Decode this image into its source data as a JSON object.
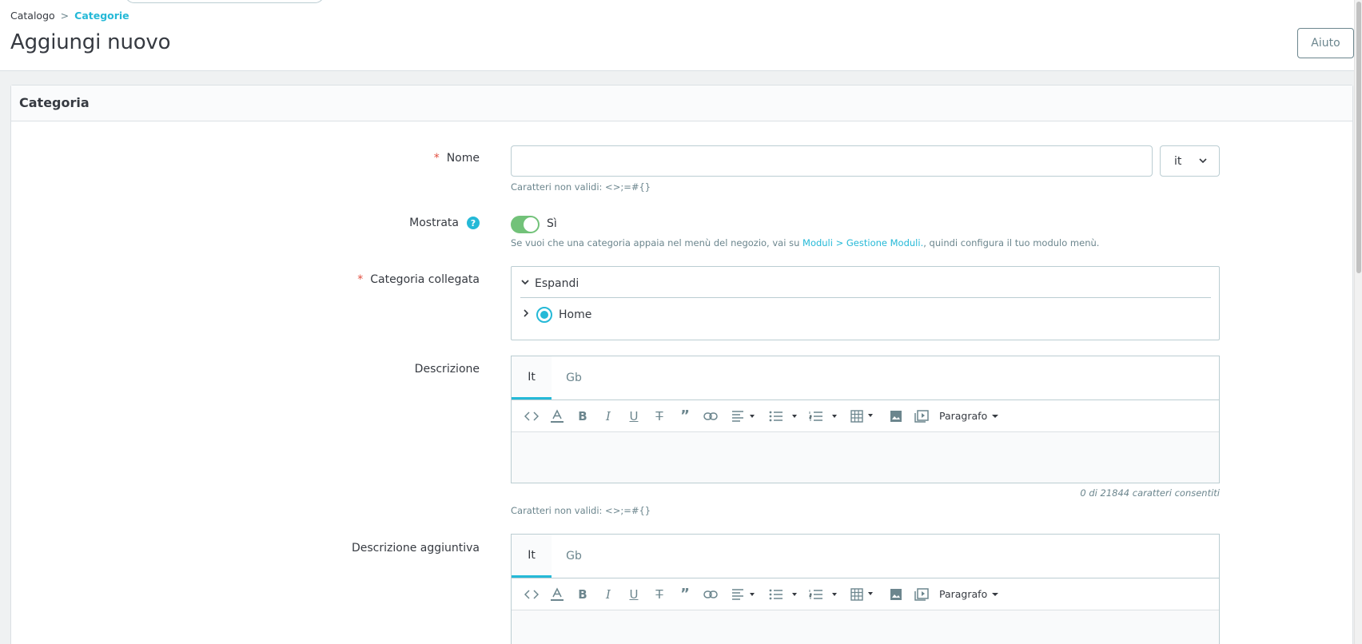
{
  "breadcrumb": {
    "parent": "Catalogo",
    "separator": ">",
    "current": "Categorie"
  },
  "page": {
    "title": "Aggiungi nuovo",
    "help_label": "Aiuto"
  },
  "card": {
    "title": "Categoria"
  },
  "form": {
    "name": {
      "label": "Nome",
      "required_mark": "*",
      "value": "",
      "lang": "it",
      "hint": "Caratteri non validi: <>;=#{}"
    },
    "displayed": {
      "label": "Mostrata",
      "help_icon": "?",
      "state_label": "Sì",
      "enabled": true,
      "hint_prefix": "Se vuoi che una categoria appaia nel menù del negozio, vai su ",
      "hint_link": "Moduli > Gestione Moduli.",
      "hint_suffix": ", quindi configura il tuo modulo menù."
    },
    "parent": {
      "label": "Categoria collegata",
      "required_mark": "*",
      "expand_label": "Espandi",
      "root_label": "Home"
    },
    "description": {
      "label": "Descrizione",
      "tabs": [
        "It",
        "Gb"
      ],
      "format_label": "Paragrafo",
      "counter": "0 di 21844 caratteri consentiti",
      "hint": "Caratteri non validi: <>;=#{}"
    },
    "additional_description": {
      "label": "Descrizione aggiuntiva",
      "tabs": [
        "It",
        "Gb"
      ],
      "format_label": "Paragrafo"
    }
  },
  "colors": {
    "accent": "#25b9d7",
    "toggle_on": "#72c279",
    "required": "#e24e3f"
  }
}
